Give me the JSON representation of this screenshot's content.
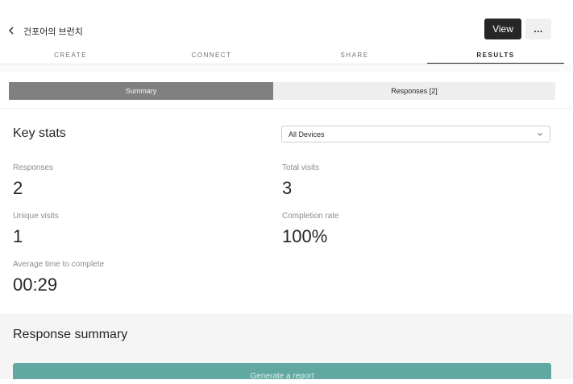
{
  "header": {
    "title": "건포어의 브런치",
    "view_label": "View",
    "more_label": "..."
  },
  "tabs": [
    {
      "label": "CREATE"
    },
    {
      "label": "CONNECT"
    },
    {
      "label": "SHARE"
    },
    {
      "label": "RESULTS"
    }
  ],
  "active_tab": "RESULTS",
  "toggle": {
    "summary_label": "Summary",
    "responses_label": "Responses [2]"
  },
  "key_stats": {
    "title": "Key stats",
    "device_filter": "All Devices",
    "responses": {
      "label": "Responses",
      "value": "2"
    },
    "total_visits": {
      "label": "Total visits",
      "value": "3"
    },
    "unique_visits": {
      "label": "Unique visits",
      "value": "1"
    },
    "completion_rate": {
      "label": "Completion rate",
      "value": "100%"
    },
    "avg_time": {
      "label": "Average time to complete",
      "value": "00:29"
    }
  },
  "response_summary": {
    "title": "Response summary",
    "generate_label": "Generate a report"
  },
  "colors": {
    "accent": "#61a8a1",
    "dark": "#262627",
    "segment_active": "#808080"
  }
}
